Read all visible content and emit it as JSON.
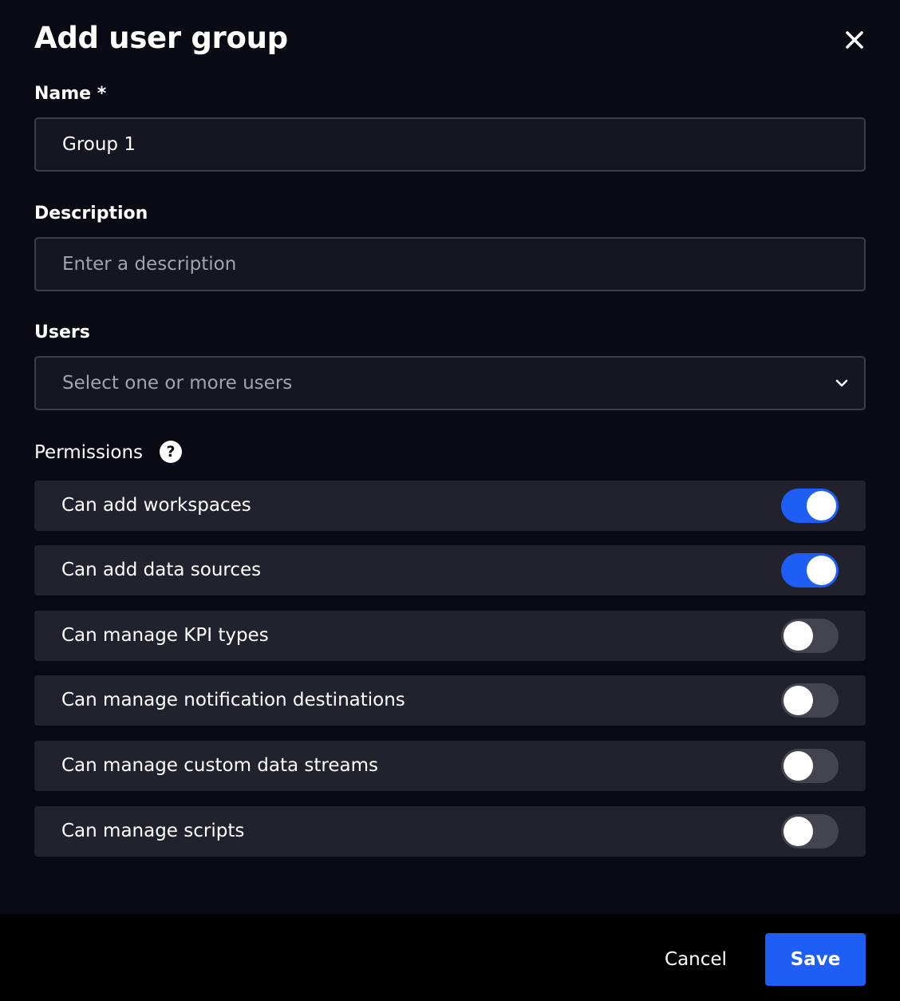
{
  "dialog": {
    "title": "Add user group"
  },
  "icons": {
    "close": "close-icon",
    "chevron": "chevron-down-icon",
    "help": "help-icon"
  },
  "name": {
    "label": "Name *",
    "value": "Group 1"
  },
  "description": {
    "label": "Description",
    "placeholder": "Enter a description"
  },
  "users": {
    "label": "Users",
    "placeholder": "Select one or more users"
  },
  "permissions": {
    "label": "Permissions",
    "help_glyph": "?",
    "items": [
      {
        "label": "Can add workspaces",
        "enabled": true
      },
      {
        "label": "Can add data sources",
        "enabled": true
      },
      {
        "label": "Can manage KPI types",
        "enabled": false
      },
      {
        "label": "Can manage notification destinations",
        "enabled": false
      },
      {
        "label": "Can manage custom data streams",
        "enabled": false
      },
      {
        "label": "Can manage scripts",
        "enabled": false
      }
    ]
  },
  "footer": {
    "cancel_label": "Cancel",
    "save_label": "Save"
  },
  "colors": {
    "accent": "#1f5ef5",
    "background": "#0a0a14",
    "row_background": "#22222f",
    "toggle_off": "#444450"
  }
}
